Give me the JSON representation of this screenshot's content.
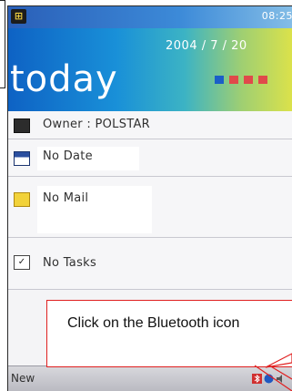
{
  "status_bar": {
    "clock": "08:25"
  },
  "header": {
    "date": "2004 / 7 / 20",
    "title": "today",
    "accent_colors": [
      "#1a5ec8",
      "#e04a4a"
    ]
  },
  "items": [
    {
      "icon": "owner-card-icon",
      "label": "Owner : POLSTAR"
    },
    {
      "icon": "calendar-icon",
      "label": "No Date"
    },
    {
      "icon": "mail-icon",
      "label": "No Mail"
    },
    {
      "icon": "tasks-icon",
      "label": "No Tasks"
    }
  ],
  "callout": {
    "text": "Click on the Bluetooth icon",
    "border_color": "#e02020"
  },
  "bottom_bar": {
    "new_label": "New",
    "tray_icons": [
      "bluetooth-icon",
      "connectivity-icon",
      "speaker-icon"
    ]
  }
}
